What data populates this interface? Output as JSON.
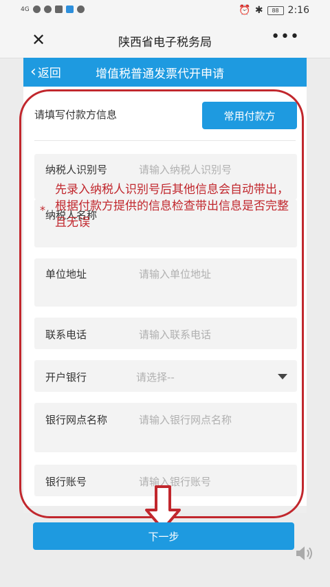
{
  "status_bar": {
    "signal": "4G",
    "time": "2:16",
    "battery": "88"
  },
  "app": {
    "title": "陕西省电子税务局",
    "close_icon": "close-icon",
    "more_icon": "more-icon"
  },
  "header": {
    "back_label": "返回",
    "title": "增值税普通发票代开申请"
  },
  "form": {
    "section_label": "请填写付款方信息",
    "common_payer_button": "常用付款方",
    "fields": [
      {
        "label": "纳税人识别号",
        "placeholder": "请输入纳税人识别号"
      },
      {
        "label": "纳税人名称",
        "placeholder": ""
      },
      {
        "label": "单位地址",
        "placeholder": "请输入单位地址"
      },
      {
        "label": "联系电话",
        "placeholder": "请输入联系电话"
      },
      {
        "label": "开户银行",
        "placeholder": "请选择--"
      },
      {
        "label": "银行网点名称",
        "placeholder": "请输入银行网点名称"
      },
      {
        "label": "银行账号",
        "placeholder": "请输入银行账号"
      }
    ]
  },
  "annotation": {
    "required_mark": "*",
    "note": "先录入纳税人识别号后其他信息会自动带出，根据付款方提供的信息检查带出信息是否完整且无误",
    "color": "#c1272d"
  },
  "next_button": "下一步",
  "colors": {
    "accent": "#1e9ae0",
    "background": "#ececec"
  }
}
